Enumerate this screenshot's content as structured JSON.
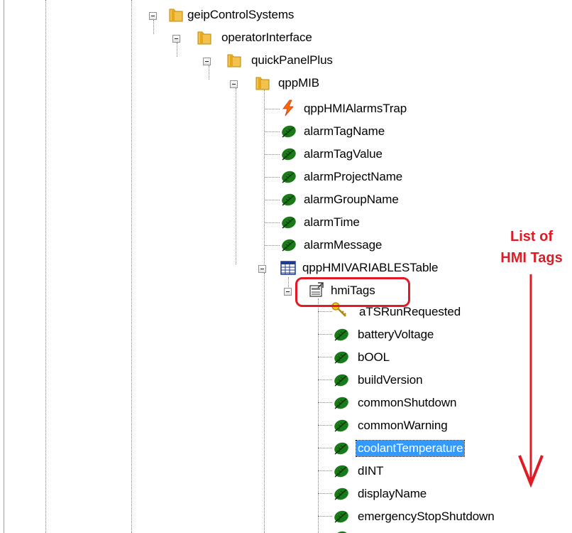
{
  "tree": {
    "nodes": [
      {
        "label": "geipControlSystems",
        "icon": "folder-icon"
      },
      {
        "label": "operatorInterface",
        "icon": "folder-icon"
      },
      {
        "label": "quickPanelPlus",
        "icon": "folder-icon"
      },
      {
        "label": "qppMIB",
        "icon": "folder-icon"
      },
      {
        "label": "qppHMIAlarmsTrap",
        "icon": "trap-lightning-icon"
      },
      {
        "label": "alarmTagName",
        "icon": "leaf-icon"
      },
      {
        "label": "alarmTagValue",
        "icon": "leaf-icon"
      },
      {
        "label": "alarmProjectName",
        "icon": "leaf-icon"
      },
      {
        "label": "alarmGroupName",
        "icon": "leaf-icon"
      },
      {
        "label": "alarmTime",
        "icon": "leaf-icon"
      },
      {
        "label": "alarmMessage",
        "icon": "leaf-icon"
      },
      {
        "label": "qppHMIVARIABLESTable",
        "icon": "table-icon"
      },
      {
        "label": "hmiTags",
        "icon": "table-entry-icon"
      },
      {
        "label": "aTSRunRequested",
        "icon": "key-icon"
      },
      {
        "label": "batteryVoltage",
        "icon": "leaf-icon"
      },
      {
        "label": "bOOL",
        "icon": "leaf-icon"
      },
      {
        "label": "buildVersion",
        "icon": "leaf-icon"
      },
      {
        "label": "commonShutdown",
        "icon": "leaf-icon"
      },
      {
        "label": "commonWarning",
        "icon": "leaf-icon"
      },
      {
        "label": "coolantTemperature",
        "icon": "leaf-icon",
        "selected": true
      },
      {
        "label": "dINT",
        "icon": "leaf-icon"
      },
      {
        "label": "displayName",
        "icon": "leaf-icon"
      },
      {
        "label": "emergencyStopShutdown",
        "icon": "leaf-icon"
      }
    ]
  },
  "annotation": {
    "line1": "List of",
    "line2": "HMI Tags",
    "color": "#e01b24"
  },
  "colors": {
    "selection": "#3399ff",
    "leaf": "#1a7a1a",
    "folder": "#f2c14e",
    "highlight_box": "#e01b24"
  }
}
